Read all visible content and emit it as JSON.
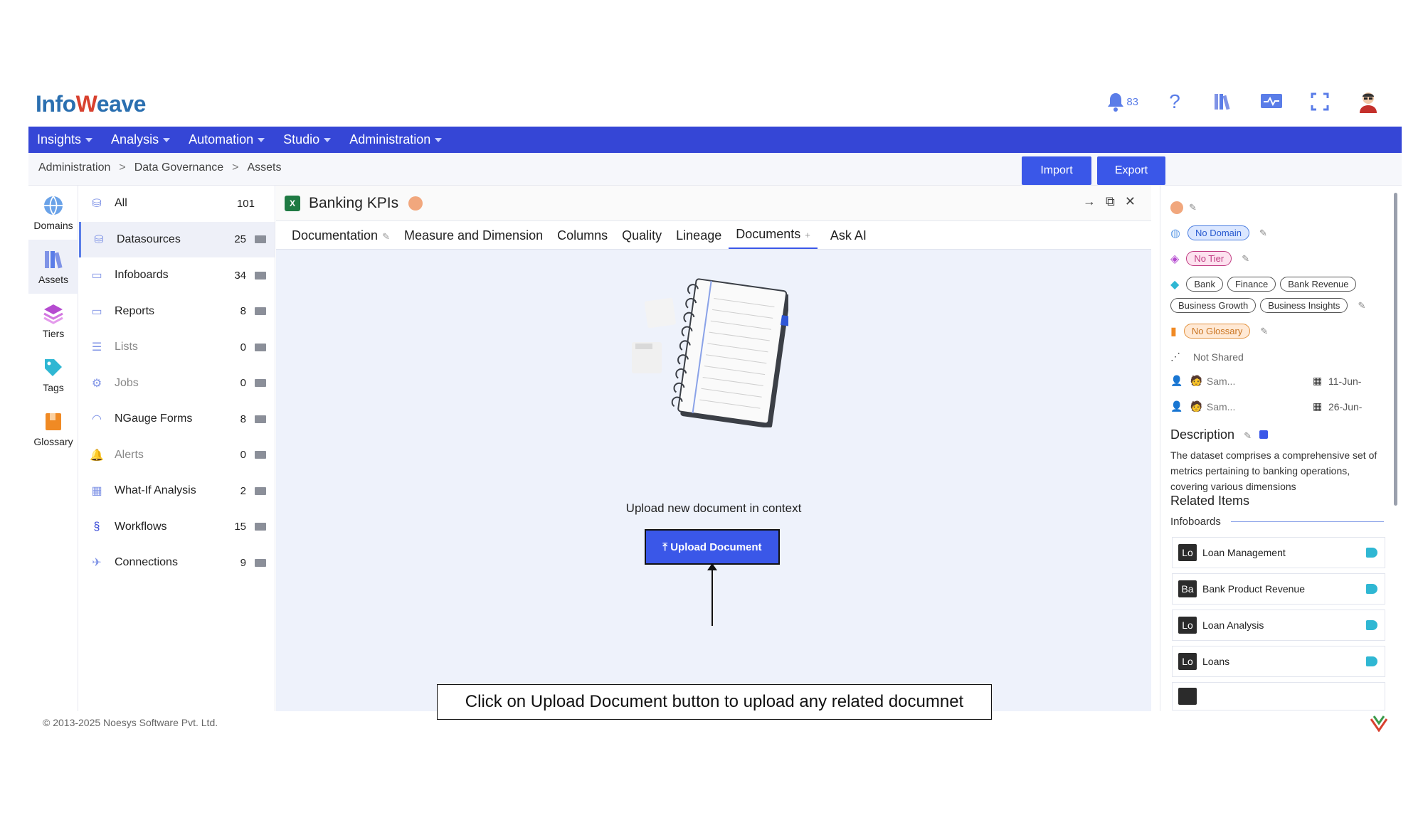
{
  "brand": {
    "name_prefix": "Info",
    "name_w": "W",
    "name_suffix": "eave"
  },
  "header": {
    "notif_count": "83",
    "icons": [
      "bell-icon",
      "help-icon",
      "library-icon",
      "monitor-icon",
      "fullscreen-icon",
      "avatar-icon"
    ]
  },
  "nav": {
    "items": [
      "Insights",
      "Analysis",
      "Automation",
      "Studio",
      "Administration"
    ]
  },
  "breadcrumb": [
    "Administration",
    "Data Governance",
    "Assets"
  ],
  "actions": {
    "import": "Import",
    "export": "Export"
  },
  "rail": {
    "items": [
      "Domains",
      "Assets",
      "Tiers",
      "Tags",
      "Glossary"
    ]
  },
  "assets": {
    "items": [
      {
        "label": "All",
        "count": "101"
      },
      {
        "label": "Datasources",
        "count": "25"
      },
      {
        "label": "Infoboards",
        "count": "34"
      },
      {
        "label": "Reports",
        "count": "8"
      },
      {
        "label": "Lists",
        "count": "0"
      },
      {
        "label": "Jobs",
        "count": "0"
      },
      {
        "label": "NGauge Forms",
        "count": "8"
      },
      {
        "label": "Alerts",
        "count": "0"
      },
      {
        "label": "What-If Analysis",
        "count": "2"
      },
      {
        "label": "Workflows",
        "count": "15"
      },
      {
        "label": "Connections",
        "count": "9"
      }
    ]
  },
  "main": {
    "title": "Banking KPIs",
    "tabs": [
      "Documentation",
      "Measure and Dimension",
      "Columns",
      "Quality",
      "Lineage",
      "Documents",
      "Ask AI"
    ],
    "empty_text": "Upload new document in context",
    "upload_label": "⤒ Upload Document"
  },
  "callout": {
    "text": "Click on Upload Document button to upload any related documnet"
  },
  "details": {
    "domain": "No Domain",
    "tier": "No Tier",
    "tags": [
      "Bank",
      "Finance",
      "Bank Revenue",
      "Business Growth",
      "Business Insights"
    ],
    "glossary": "No Glossary",
    "sharing": "Not Shared",
    "created_by": "Sam...",
    "created_on": "11-Jun-",
    "modified_by": "Sam...",
    "modified_on": "26-Jun-",
    "description_title": "Description",
    "description": "The dataset comprises a comprehensive set of metrics pertaining to banking operations, covering various dimensions",
    "related_title": "Related Items",
    "related_group": "Infoboards",
    "related": [
      {
        "abbr": "Lo",
        "name": "Loan Management"
      },
      {
        "abbr": "Ba",
        "name": "Bank Product Revenue"
      },
      {
        "abbr": "Lo",
        "name": "Loan Analysis"
      },
      {
        "abbr": "Lo",
        "name": "Loans"
      }
    ]
  },
  "footer": {
    "text": "© 2013-2025 Noesys Software Pvt. Ltd."
  },
  "colors": {
    "primary": "#3546d6",
    "button": "#3a57e8",
    "panel_bg": "#eef2fb"
  }
}
